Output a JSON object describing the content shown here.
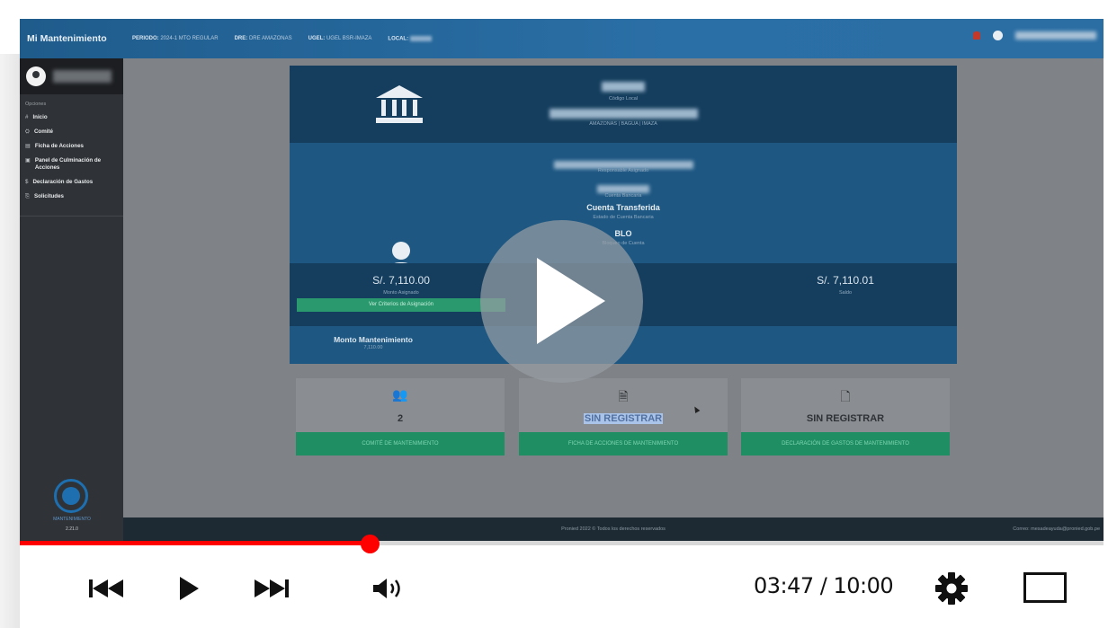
{
  "app": {
    "title": "Mi Mantenimiento",
    "header": {
      "periodo_label": "PERIODO:",
      "periodo_value": "2024-1 MTO REGULAR",
      "dre_label": "DRE:",
      "dre_value": "DRE AMAZONAS",
      "ugel_label": "UGEL:",
      "ugel_value": "UGEL BSR-IMAZA",
      "local_label": "LOCAL:"
    },
    "sidebar": {
      "section_label": "Opciones",
      "items": [
        {
          "icon": "#",
          "label": "Inicio"
        },
        {
          "icon": "⛭",
          "label": "Comité"
        },
        {
          "icon": "▤",
          "label": "Ficha de Acciones"
        },
        {
          "icon": "▣",
          "label": "Panel de Culminación de Acciones"
        },
        {
          "icon": "$",
          "label": "Declaración de Gastos"
        },
        {
          "icon": "⎘",
          "label": "Solicitudes"
        }
      ],
      "logo_text": "MANTENIMIENTO",
      "version": "2.21.0"
    },
    "local_panel": {
      "codigo_local_label": "Código Local",
      "location": "AMAZONAS | BAGUA | IMAZA"
    },
    "responsable_panel": {
      "responsable_label": "Responsable Asignado",
      "cuenta_label": "Cuenta Bancaria",
      "estado_cuenta_value": "Cuenta Transferida",
      "estado_cuenta_label": "Estado de Cuenta Bancaria",
      "bloqueo_value": "BLO",
      "bloqueo_label": "Bloqueo de Cuenta"
    },
    "amounts": {
      "asignado_value": "S/. 7,110.00",
      "asignado_label": "Monto Asignado",
      "criterios_button": "Ver Criterios de Asignación",
      "saldo_value": "S/. 7,110.01",
      "saldo_label": "Saldo"
    },
    "mantenimiento": {
      "label": "Monto Mantenimiento",
      "value": "7,110.00"
    },
    "cards": [
      {
        "icon": "users-icon",
        "glyph": "👥",
        "value": "2",
        "button": "COMITÉ DE MANTENIMIENTO"
      },
      {
        "icon": "document-outline-icon",
        "glyph": "🗎",
        "value": "SIN REGISTRAR",
        "button": "FICHA DE ACCIONES DE MANTENIMIENTO"
      },
      {
        "icon": "document-filled-icon",
        "glyph": "🗋",
        "value": "SIN REGISTRAR",
        "button": "DECLARACIÓN DE GASTOS DE MANTENIMIENTO"
      }
    ],
    "footer": {
      "copyright": "Pronied 2022 © Todos los derechos reservados",
      "contact": "Correo: mesadeayuda@pronied.gob.pe"
    }
  },
  "player": {
    "current_time": "03:47",
    "separator": " / ",
    "duration": "10:00",
    "progress_fraction": 0.323,
    "accent_color": "#ff0000",
    "controls": [
      "previous-icon",
      "play-icon",
      "next-icon",
      "volume-icon",
      "settings-gear-icon",
      "fullscreen-icon"
    ]
  }
}
